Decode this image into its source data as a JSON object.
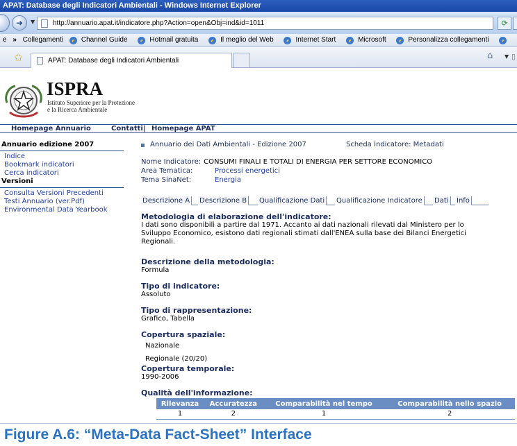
{
  "window": {
    "title": "APAT: Database degli Indicatori Ambientali - Windows Internet Explorer"
  },
  "navigation": {
    "address": "http://annuario.apat.it/indicatore.php?Action=open&Obj=ind&id=1011"
  },
  "links_bar": {
    "chevron": "»",
    "items": [
      "Collegamenti",
      "Channel Guide",
      "Hotmail gratuita",
      "Il meglio del Web",
      "Internet Start",
      "Microsoft",
      "Personalizza collegamenti"
    ]
  },
  "tab": {
    "title": "APAT: Database degli Indicatori Ambientali"
  },
  "logo": {
    "name": "ISPRA",
    "subtitle_line1": "Istituto Superiore per la Protezione",
    "subtitle_line2": "e la Ricerca Ambientale"
  },
  "topnav": {
    "homepage_annuario": "Homepage Annuario",
    "contatti": "Contatti",
    "separator": "|",
    "homepage_apat": "Homepage APAT"
  },
  "sidebar": {
    "section1": "Annuario edizione 2007",
    "items1": [
      "Indice",
      "Bookmark indicatori",
      "Cerca indicatori"
    ],
    "section2": "Versioni",
    "items2": [
      "Consulta Versioni Precedenti",
      "Testi Annuario (ver.Pdf)",
      "Environmental Data Yearbook"
    ]
  },
  "header": {
    "annuario": "Annuario dei Dati Ambientali - Edizione 2007",
    "scheda": "Scheda Indicatore: Metadati"
  },
  "meta": {
    "nome_label": "Nome Indicatore:",
    "nome_value": "CONSUMI FINALI E TOTALI DI ENERGIA PER SETTORE ECONOMICO",
    "area_label": "Area Tematica:",
    "area_value": "Processi energetici",
    "tema_label": "Tema SinaNet:",
    "tema_value": "Energia"
  },
  "tabs": [
    "Descrizione A",
    "Descrizione B",
    "Qualificazione Dati",
    "Qualificazione Indicatore",
    "Dati",
    "Info"
  ],
  "content": {
    "metodologia_title": "Metodologia di elaborazione dell'indicatore:",
    "metodologia_line1": "I dati sono disponibili a partire dal 1971. Accanto ai dati nazionali rilevati dal Ministero per lo",
    "metodologia_line2": "Sviluppo Economico, esistono dati regionali stimati dall'ENEA sulla base dei Bilanci Energetici",
    "metodologia_line3": "Regionali.",
    "descrizione_title": "Descrizione della metodologia:",
    "descrizione_value": "Formula",
    "tipo_title": "Tipo di indicatore:",
    "tipo_value": "Assoluto",
    "rappresentazione_title": "Tipo di rappresentazione:",
    "rappresentazione_value": "Grafico, Tabella",
    "copertura_spaziale_title": "Copertura spaziale:",
    "copertura_spaziale_1": "Nazionale",
    "copertura_spaziale_2": "Regionale (20/20)",
    "copertura_temporale_title": "Copertura temporale:",
    "copertura_temporale_value": "1990-2006",
    "qualita_title": "Qualità dell'informazione:"
  },
  "quality_table": {
    "headers": [
      "Rilevanza",
      "Accuratezza",
      "Comparabilità nel tempo",
      "Comparabilità nello spazio"
    ],
    "values": [
      "1",
      "2",
      "1",
      "2"
    ]
  },
  "figure_caption": "Figure A.6: “Meta-Data Fact-Sheet” Interface"
}
